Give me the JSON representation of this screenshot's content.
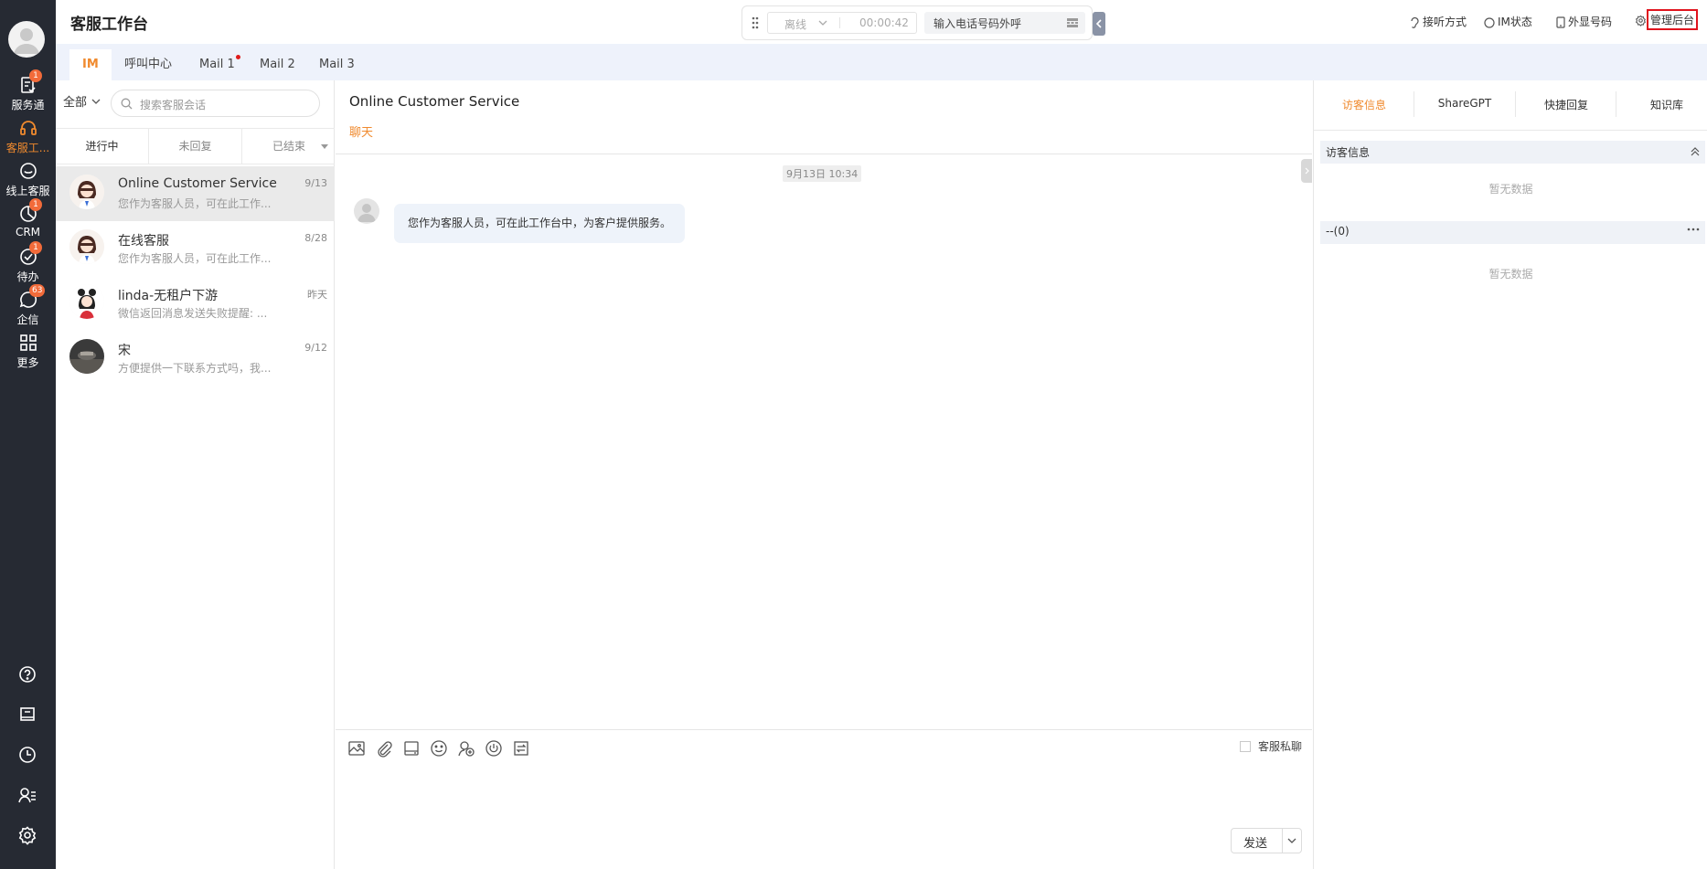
{
  "sidebar": {
    "items": [
      {
        "label": "服务通",
        "badge": "1",
        "icon": "clipboard-check-icon"
      },
      {
        "label": "客服工...",
        "badge": "",
        "icon": "headset-icon",
        "active": true
      },
      {
        "label": "线上客服",
        "badge": "",
        "icon": "smile-chat-icon"
      },
      {
        "label": "CRM",
        "badge": "1",
        "icon": "pie-chart-icon"
      },
      {
        "label": "待办",
        "badge": "1",
        "icon": "check-circle-icon"
      },
      {
        "label": "企信",
        "badge": "63",
        "icon": "chat-bubble-icon"
      },
      {
        "label": "更多",
        "badge": "",
        "icon": "grid-icon"
      }
    ],
    "bottom_icons": [
      "help-icon",
      "notebook-icon",
      "clock-icon",
      "user-list-icon",
      "settings-icon"
    ],
    "accent": "#f08a2e",
    "bg": "#262a33"
  },
  "header": {
    "title": "客服工作台",
    "callbar": {
      "status": "离线",
      "timer": "00:00:42",
      "dial_placeholder": "输入电话号码外呼"
    },
    "right": {
      "answer_mode": "接听方式",
      "im_status": "IM状态",
      "display_number": "外显号码",
      "admin": "管理后台"
    }
  },
  "tabs": [
    {
      "label": "IM",
      "active": true,
      "dot": false
    },
    {
      "label": "呼叫中心",
      "active": false,
      "dot": false
    },
    {
      "label": "Mail 1",
      "active": false,
      "dot": true
    },
    {
      "label": "Mail 2",
      "active": false,
      "dot": false
    },
    {
      "label": "Mail 3",
      "active": false,
      "dot": false
    }
  ],
  "conversations": {
    "filter": "全部",
    "search_placeholder": "搜索客服会话",
    "subtabs": [
      "进行中",
      "未回复",
      "已结束"
    ],
    "list": [
      {
        "name": "Online Customer Service",
        "date": "9/13",
        "preview": "您作为客服人员，可在此工作...",
        "selected": true,
        "avatar": "woman-agent-avatar"
      },
      {
        "name": "在线客服",
        "date": "8/28",
        "preview": "您作为客服人员，可在此工作...",
        "selected": false,
        "avatar": "woman-agent-avatar"
      },
      {
        "name": "linda-无租户下游",
        "date": "昨天",
        "preview": "微信返回消息发送失败提醒: ...",
        "selected": false,
        "avatar": "girl-avatar"
      },
      {
        "name": "宋",
        "date": "9/12",
        "preview": "方便提供一下联系方式吗，我...",
        "selected": false,
        "avatar": "photo-avatar"
      }
    ]
  },
  "chat": {
    "title": "Online Customer Service",
    "subtitle": "聊天",
    "time": "9月13日 10:34",
    "message": "您作为客服人员，可在此工作台中，为客户提供服务。",
    "toolbar_icons": [
      "image-icon",
      "attachment-icon",
      "drive-icon",
      "emoji-icon",
      "add-user-icon",
      "power-icon",
      "transfer-icon"
    ],
    "private_chat": "客服私聊",
    "send": "发送"
  },
  "right_panel": {
    "tabs": [
      "访客信息",
      "ShareGPT",
      "快捷回复",
      "知识库"
    ],
    "section1": "访客信息",
    "empty1": "暂无数据",
    "section2": "--(0)",
    "empty2": "暂无数据"
  }
}
